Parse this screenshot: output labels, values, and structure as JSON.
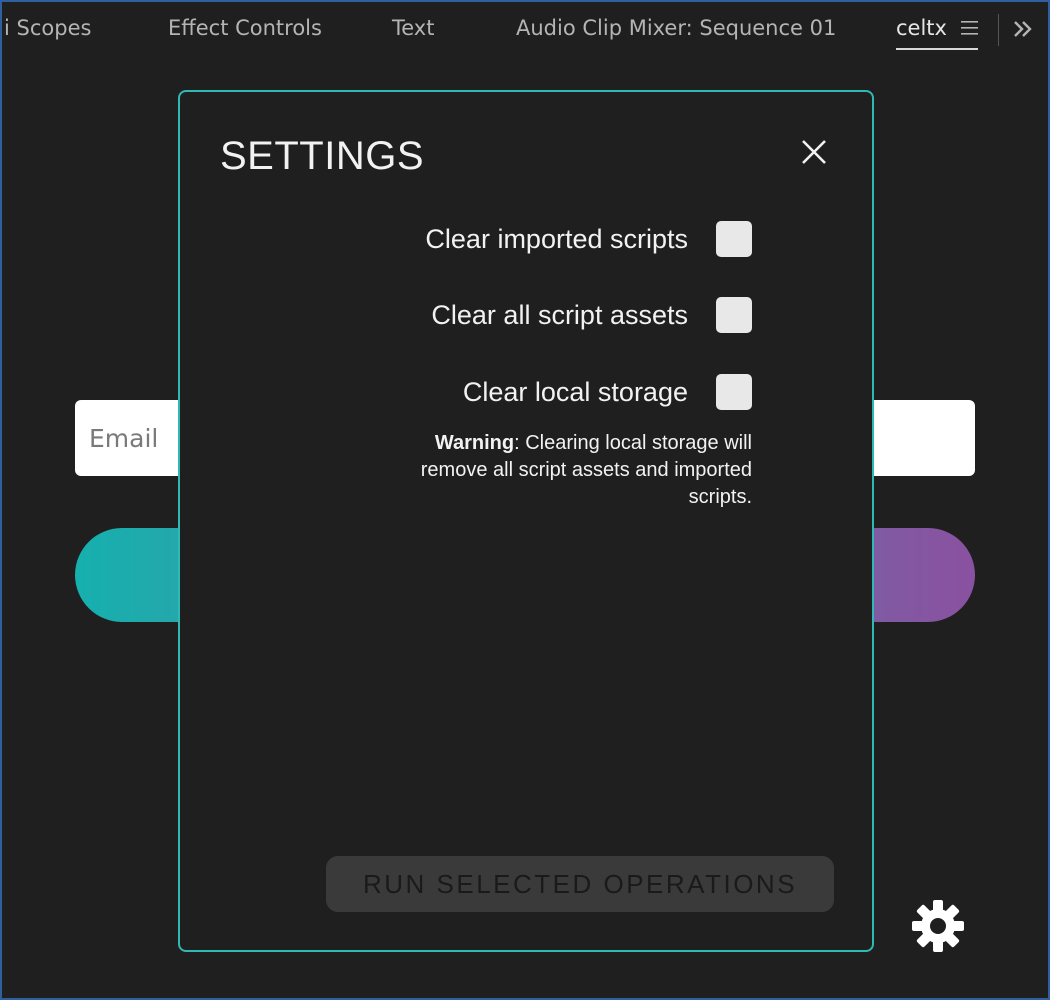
{
  "tabs": [
    {
      "label": "i Scopes",
      "active": false
    },
    {
      "label": "Effect Controls",
      "active": false
    },
    {
      "label": "Text",
      "active": false
    },
    {
      "label": "Audio Clip Mixer: Sequence 01",
      "active": false
    },
    {
      "label": "celtx",
      "active": true
    }
  ],
  "tab_icons": {
    "menu": "hamburger-menu-icon",
    "overflow": "double-chevron-right-icon"
  },
  "panel": {
    "email_placeholder": "Email",
    "settings_icon": "gear-icon"
  },
  "modal": {
    "title": "SETTINGS",
    "close_icon": "close-icon",
    "options": [
      {
        "label": "Clear imported scripts",
        "checked": false
      },
      {
        "label": "Clear all script assets",
        "checked": false
      },
      {
        "label": "Clear local storage",
        "checked": false
      }
    ],
    "warning_label": "Warning",
    "warning_text": ": Clearing local storage will remove all script assets and imported scripts.",
    "run_button_label": "RUN SELECTED OPERATIONS",
    "run_button_enabled": false
  },
  "colors": {
    "modal_border": "#2fb8b4",
    "gradient_start": "#16b0ae",
    "gradient_end": "#8a51a0",
    "window_border": "#2f5f9e"
  }
}
